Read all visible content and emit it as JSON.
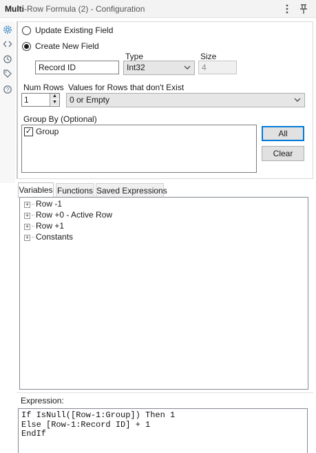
{
  "window": {
    "title_bold": "Multi",
    "title_rest": "-Row Formula (2) - Configuration",
    "menu_icon": "vertical-ellipsis-icon",
    "pin_icon": "pin-icon"
  },
  "rail": {
    "icons": [
      "gear-icon",
      "code-icon",
      "history-icon",
      "tag-icon",
      "help-icon"
    ]
  },
  "config": {
    "update_existing_label": "Update Existing Field",
    "create_new_label": "Create New  Field",
    "type_label": "Type",
    "size_label": "Size",
    "field_name_value": "Record ID",
    "type_value": "Int32",
    "size_value": "4",
    "num_rows_label": "Num Rows",
    "num_rows_value": "1",
    "nonexist_label": "Values for Rows that don't Exist",
    "nonexist_value": "0 or Empty",
    "group_by_label": "Group By (Optional)",
    "group_items": [
      {
        "label": "Group",
        "checked": true
      }
    ],
    "all_button": "All",
    "clear_button": "Clear"
  },
  "tabs": [
    "Variables",
    "Functions",
    "Saved Expressions"
  ],
  "tree": [
    "Row -1",
    "Row +0 - Active Row",
    "Row +1",
    "Constants"
  ],
  "expression": {
    "label": "Expression:",
    "text": "If IsNull([Row-1:Group]) Then 1\nElse [Row-1:Record ID] + 1\nEndIf"
  }
}
